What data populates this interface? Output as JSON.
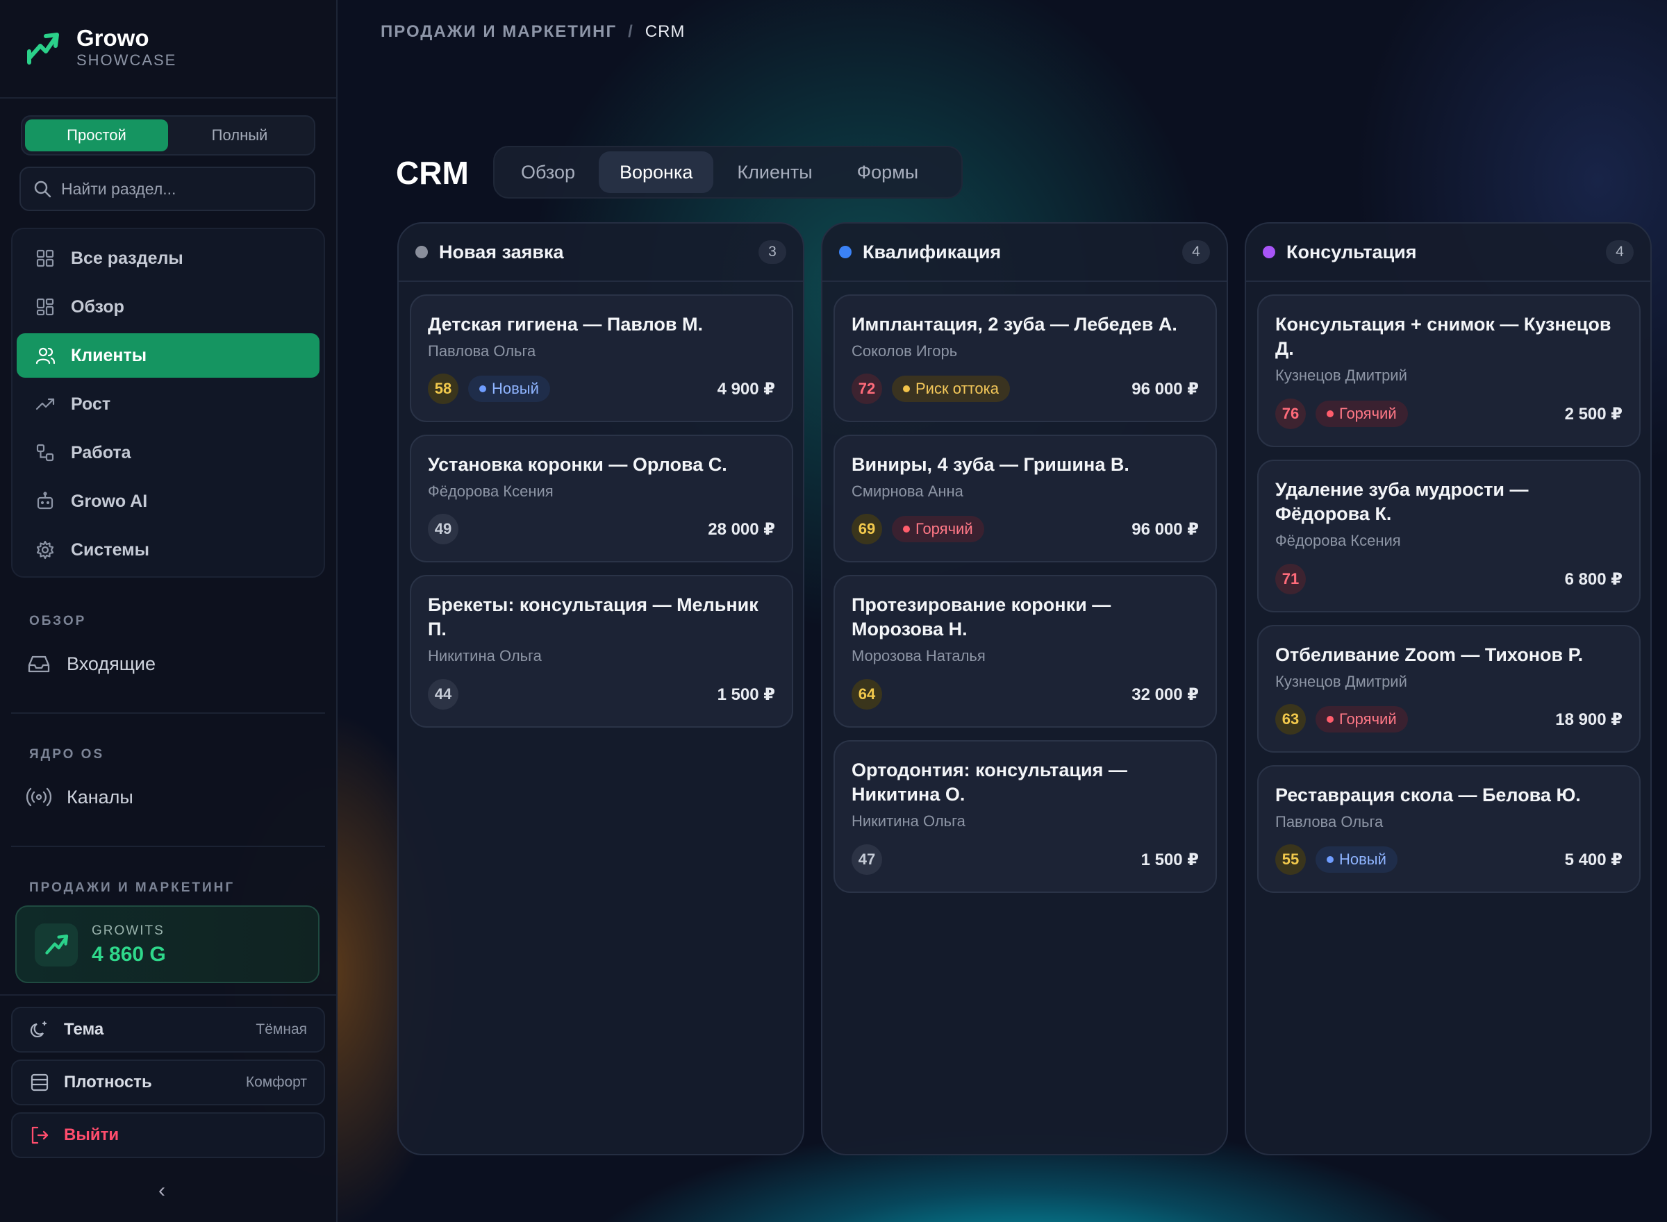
{
  "app": {
    "name": "Growo",
    "subtitle": "SHOWCASE"
  },
  "mode": {
    "simple": "Простой",
    "full": "Полный"
  },
  "search": {
    "placeholder": "Найти раздел..."
  },
  "nav": {
    "items": [
      {
        "label": "Все разделы",
        "icon": "grid-icon"
      },
      {
        "label": "Обзор",
        "icon": "grid-icon"
      },
      {
        "label": "Клиенты",
        "icon": "users-icon",
        "active": true
      },
      {
        "label": "Рост",
        "icon": "trend-icon"
      },
      {
        "label": "Работа",
        "icon": "workflow-icon"
      },
      {
        "label": "Growo AI",
        "icon": "bot-icon"
      },
      {
        "label": "Системы",
        "icon": "gear-icon"
      }
    ]
  },
  "sections": {
    "overview": {
      "title": "ОБЗОР",
      "link": "Входящие"
    },
    "core": {
      "title": "ЯДРО OS",
      "link": "Каналы"
    },
    "sales": {
      "title": "ПРОДАЖИ И МАРКЕТИНГ"
    }
  },
  "growits": {
    "label": "GROWITS",
    "value": "4 860 G"
  },
  "settings": {
    "theme": {
      "label": "Тема",
      "value": "Тёмная"
    },
    "density": {
      "label": "Плотность",
      "value": "Комфорт"
    },
    "logout": {
      "label": "Выйти"
    },
    "collapse": "‹"
  },
  "breadcrumb": {
    "parent": "ПРОДАЖИ И МАРКЕТИНГ",
    "separator": "/",
    "current": "CRM"
  },
  "page": {
    "title": "CRM"
  },
  "tabs": [
    "Обзор",
    "Воронка",
    "Клиенты",
    "Формы"
  ],
  "activeTab": "Воронка",
  "colors": {
    "accent": "#159561",
    "newDot": "#8a8f9c",
    "qualDot": "#3b82f6",
    "consDot": "#a855f7"
  },
  "board": {
    "columns": [
      {
        "name": "Новая заявка",
        "count": "3",
        "cards": [
          {
            "title": "Детская гигиена — Павлов М.",
            "person": "Павлова Ольга",
            "score": "58",
            "tag": "Новый",
            "amount": "4 900 ₽"
          },
          {
            "title": "Установка коронки — Орлова С.",
            "person": "Фёдорова Ксения",
            "score": "49",
            "amount": "28 000 ₽"
          },
          {
            "title": "Брекеты: консультация — Мельник П.",
            "person": "Никитина Ольга",
            "score": "44",
            "amount": "1 500 ₽"
          }
        ]
      },
      {
        "name": "Квалификация",
        "count": "4",
        "cards": [
          {
            "title": "Имплантация, 2 зуба — Лебедев А.",
            "person": "Соколов Игорь",
            "score": "72",
            "tag": "Риск оттока",
            "amount": "96 000 ₽"
          },
          {
            "title": "Виниры, 4 зуба — Гришина В.",
            "person": "Смирнова Анна",
            "score": "69",
            "tag": "Горячий",
            "amount": "96 000 ₽"
          },
          {
            "title": "Протезирование коронки — Морозова Н.",
            "person": "Морозова Наталья",
            "score": "64",
            "amount": "32 000 ₽"
          },
          {
            "title": "Ортодонтия: консультация — Никитина О.",
            "person": "Никитина Ольга",
            "score": "47",
            "amount": "1 500 ₽"
          }
        ]
      },
      {
        "name": "Консультация",
        "count": "4",
        "cards": [
          {
            "title": "Консультация + снимок — Кузнецов Д.",
            "person": "Кузнецов Дмитрий",
            "score": "76",
            "tag": "Горячий",
            "amount": "2 500 ₽"
          },
          {
            "title": "Удаление зуба мудрости — Фёдорова К.",
            "person": "Фёдорова Ксения",
            "score": "71",
            "amount": "6 800 ₽"
          },
          {
            "title": "Отбеливание Zoom — Тихонов Р.",
            "person": "Кузнецов Дмитрий",
            "score": "63",
            "tag": "Горячий",
            "amount": "18 900 ₽"
          },
          {
            "title": "Реставрация скола — Белова Ю.",
            "person": "Павлова Ольга",
            "score": "55",
            "tag": "Новый",
            "amount": "5 400 ₽"
          }
        ]
      }
    ]
  }
}
